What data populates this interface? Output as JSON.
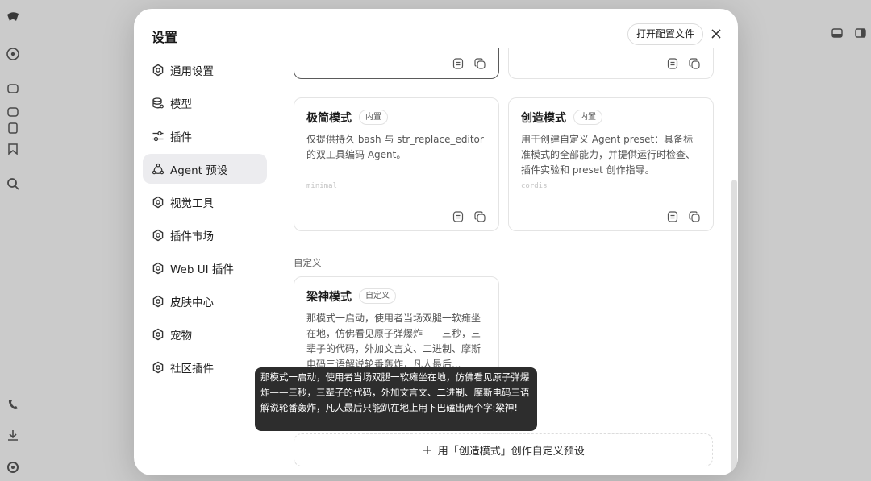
{
  "background": {
    "rail_icons": [
      "app-logo-icon",
      "add-icon",
      "chat-icon",
      "chat-icon",
      "document-icon",
      "bookmark-icon",
      "search-icon",
      "phone-icon",
      "download-icon",
      "settings-icon"
    ],
    "topright_icons": [
      "sidebar-toggle-icon",
      "panel-icon"
    ]
  },
  "modal": {
    "title": "设置",
    "open_config_label": "打开配置文件",
    "close_icon": "close-icon"
  },
  "sidebar": {
    "items": [
      {
        "label": "通用设置",
        "icon": "gear-icon",
        "active": false
      },
      {
        "label": "模型",
        "icon": "database-icon",
        "active": false
      },
      {
        "label": "插件",
        "icon": "sliders-icon",
        "active": false
      },
      {
        "label": "Agent 预设",
        "icon": "agent-icon",
        "active": true
      },
      {
        "label": "视觉工具",
        "icon": "gear-icon",
        "active": false
      },
      {
        "label": "插件市场",
        "icon": "gear-icon",
        "active": false
      },
      {
        "label": "Web UI 插件",
        "icon": "gear-icon",
        "active": false
      },
      {
        "label": "皮肤中心",
        "icon": "gear-icon",
        "active": false
      },
      {
        "label": "宠物",
        "icon": "gear-icon",
        "active": false
      },
      {
        "label": "社区插件",
        "icon": "gear-icon",
        "active": false
      }
    ]
  },
  "presets": {
    "builtin": [
      {
        "title": "极简模式",
        "badge": "内置",
        "desc": "仅提供持久 bash 与 str_replace_editor 的双工具编码 Agent。",
        "id": "minimal"
      },
      {
        "title": "创造模式",
        "badge": "内置",
        "desc": "用于创建自定义 Agent preset：具备标准模式的全部能力，并提供运行时检查、插件实验和 preset 创作指导。",
        "id": "cordis"
      }
    ],
    "custom_section_label": "自定义",
    "custom": [
      {
        "title": "梁神模式",
        "badge": "自定义",
        "desc": "那模式一启动，使用者当场双腿一软瘫坐在地，仿佛看见原子弹爆炸——三秒，三辈子的代码，外加文言文、二进制、摩斯电码三语解说轮番轰炸，凡人最后..."
      }
    ],
    "create_label": "用「创造模式」创作自定义预设"
  },
  "tooltip": {
    "text": "那模式一启动，使用者当场双腿一软瘫坐在地，仿佛看见原子弹爆炸——三秒，三辈子的代码，外加文言文、二进制、摩斯电码三语解说轮番轰炸，凡人最后只能趴在地上用下巴磕出两个字:梁神!"
  }
}
